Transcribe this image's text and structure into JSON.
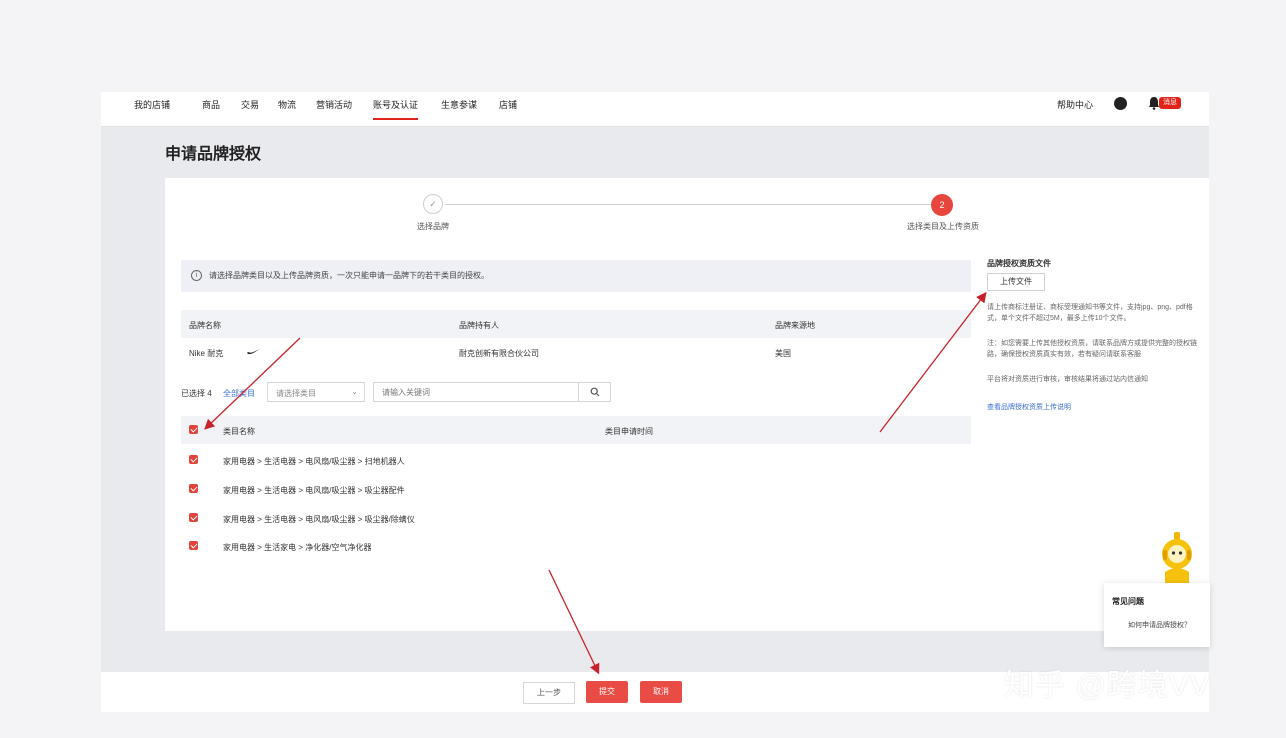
{
  "nav": {
    "items": [
      {
        "label": "我的店铺",
        "active": false
      },
      {
        "label": "商品",
        "active": false
      },
      {
        "label": "交易",
        "active": false
      },
      {
        "label": "物流",
        "active": false
      },
      {
        "label": "营销活动",
        "active": false
      },
      {
        "label": "账号及认证",
        "active": true
      },
      {
        "label": "生意参谋",
        "active": false
      },
      {
        "label": "店铺",
        "active": false
      }
    ],
    "help_center": "帮助中心",
    "bell_badge": "消息"
  },
  "page": {
    "title": "申请品牌授权"
  },
  "steps": {
    "step1": {
      "label": "选择品牌",
      "mark": "✓"
    },
    "step2": {
      "label": "选择类目及上传资质",
      "mark": "2"
    }
  },
  "info": {
    "text": "请选择品牌类目以及上传品牌资质，一次只能申请一品牌下的若干类目的授权。"
  },
  "brand_table": {
    "headers": [
      "品牌名称",
      "品牌持有人",
      "品牌来源地"
    ],
    "row": {
      "name": "Nike 耐克",
      "holder": "耐克创新有限合伙公司",
      "origin": "美国"
    }
  },
  "filter": {
    "selected_count": "已选择 4",
    "select_all": "全部类目",
    "dropdown_placeholder": "请选择类目",
    "search_placeholder": "请输入关键词"
  },
  "category_table": {
    "headers": [
      "类目名称",
      "类目申请时间"
    ],
    "rows": [
      "家用电器 > 生活电器 > 电风扇/吸尘器 > 扫地机器人",
      "家用电器 > 生活电器 > 电风扇/吸尘器 > 吸尘器配件",
      "家用电器 > 生活电器 > 电风扇/吸尘器 > 吸尘器/除螨仪",
      "家用电器 > 生活家电 > 净化器/空气净化器"
    ]
  },
  "right_panel": {
    "title": "品牌授权资质文件",
    "upload_button": "上传文件",
    "desc1": "请上传商标注册证、商标受理通知书等文件，支持jpg、png、pdf格式，单个文件不超过5M，最多上传10个文件。",
    "desc2": "注：如您需要上传其他授权资质，请联系品牌方或提供完整的授权链路，确保授权资质真实有效，若有疑问请联系客服",
    "desc3": "平台将对资质进行审核，审核结果将通过站内信通知",
    "link": "查看品牌授权资质上传说明"
  },
  "bottom": {
    "prev_button": "上一步",
    "submit_button": "提交",
    "cancel_button": "取消"
  },
  "chat": {
    "title": "常见问题",
    "question": "如何申请品牌授权？"
  },
  "watermark": "知乎 @跨境VV",
  "colors": {
    "accent": "#e2231a",
    "button_red": "#e84c44",
    "link_blue": "#3a6fd8",
    "annotation_arrow": "#c8232c"
  }
}
